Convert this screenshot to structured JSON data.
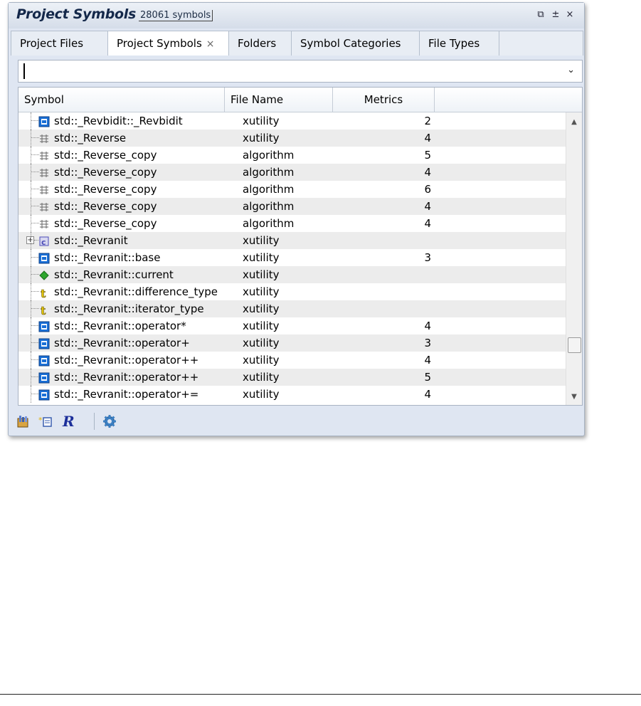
{
  "window": {
    "title": "Project Symbols",
    "count": "28061 symbols",
    "buttons": {
      "dock": "⧉",
      "pin": "±",
      "close": "×"
    }
  },
  "tabs": [
    {
      "label": "Project Files"
    },
    {
      "label": "Project Symbols",
      "close": "×"
    },
    {
      "label": "Folders"
    },
    {
      "label": "Symbol Categories"
    },
    {
      "label": "File Types"
    }
  ],
  "search": {
    "value": "",
    "placeholder": "",
    "dropdown_arrow": "⌄"
  },
  "grid": {
    "columns": [
      "Symbol",
      "File Name",
      "Metrics"
    ],
    "rows": [
      {
        "symbol": "std::_Revbidit::_Revbidit",
        "file": "xutility",
        "metric": "2",
        "icon": "method-icon"
      },
      {
        "symbol": "std::_Reverse",
        "file": "xutility",
        "metric": "4",
        "icon": "function-template-icon"
      },
      {
        "symbol": "std::_Reverse_copy",
        "file": "algorithm",
        "metric": "5",
        "icon": "function-template-icon"
      },
      {
        "symbol": "std::_Reverse_copy",
        "file": "algorithm",
        "metric": "4",
        "icon": "function-template-icon"
      },
      {
        "symbol": "std::_Reverse_copy",
        "file": "algorithm",
        "metric": "6",
        "icon": "function-template-icon"
      },
      {
        "symbol": "std::_Reverse_copy",
        "file": "algorithm",
        "metric": "4",
        "icon": "function-template-icon"
      },
      {
        "symbol": "std::_Reverse_copy",
        "file": "algorithm",
        "metric": "4",
        "icon": "function-template-icon"
      },
      {
        "symbol": "std::_Revranit",
        "file": "xutility",
        "metric": "",
        "icon": "class-template-icon",
        "expander": "+"
      },
      {
        "symbol": "std::_Revranit::base",
        "file": "xutility",
        "metric": "3",
        "icon": "method-icon"
      },
      {
        "symbol": "std::_Revranit::current",
        "file": "xutility",
        "metric": "",
        "icon": "field-icon"
      },
      {
        "symbol": "std::_Revranit::difference_type",
        "file": "xutility",
        "metric": "",
        "icon": "typedef-icon"
      },
      {
        "symbol": "std::_Revranit::iterator_type",
        "file": "xutility",
        "metric": "",
        "icon": "typedef-icon"
      },
      {
        "symbol": "std::_Revranit::operator*",
        "file": "xutility",
        "metric": "4",
        "icon": "method-icon"
      },
      {
        "symbol": "std::_Revranit::operator+",
        "file": "xutility",
        "metric": "3",
        "icon": "method-icon"
      },
      {
        "symbol": "std::_Revranit::operator++",
        "file": "xutility",
        "metric": "4",
        "icon": "method-icon"
      },
      {
        "symbol": "std::_Revranit::operator++",
        "file": "xutility",
        "metric": "5",
        "icon": "method-icon"
      },
      {
        "symbol": "std::_Revranit::operator+=",
        "file": "xutility",
        "metric": "4",
        "icon": "method-icon"
      }
    ]
  },
  "scrollbar": {
    "up": "▲",
    "down": "▼"
  },
  "toolbar": [
    {
      "icon": "sort-icon"
    },
    {
      "icon": "new-symbol-icon"
    },
    {
      "icon": "regex-icon",
      "glyph": "R"
    },
    {
      "icon": "settings-gear-icon"
    }
  ],
  "colors": {
    "method": "#1a6fd6",
    "field": "#2ea62e",
    "typedef": "#e0c200",
    "class": "#4d4db8"
  }
}
